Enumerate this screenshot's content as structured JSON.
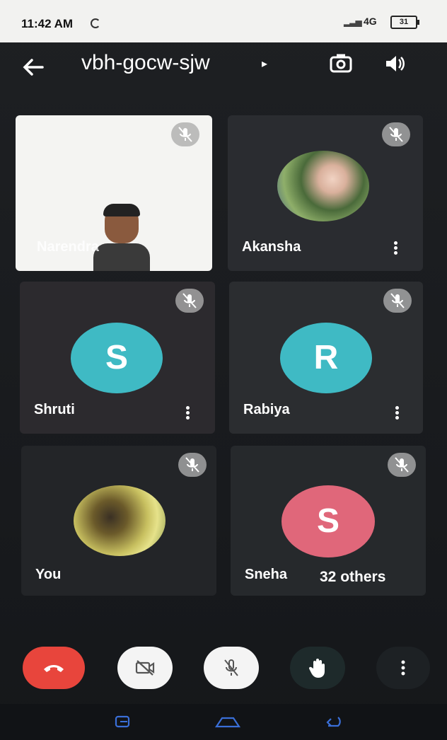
{
  "status_bar": {
    "time": "11:42 AM",
    "network": "4G",
    "battery": "31"
  },
  "header": {
    "meeting_code": "vbh-gocw-sjw"
  },
  "participants": [
    {
      "name": "Narendra",
      "muted": true,
      "type": "video"
    },
    {
      "name": "Akansha",
      "muted": true,
      "type": "photo"
    },
    {
      "name": "Shruti",
      "muted": true,
      "type": "initial",
      "initial": "S",
      "color": "#3fbac4"
    },
    {
      "name": "Rabiya",
      "muted": true,
      "type": "initial",
      "initial": "R",
      "color": "#3fbac4"
    },
    {
      "name": "You",
      "muted": true,
      "type": "photo"
    },
    {
      "name": "Sneha",
      "muted": true,
      "type": "initial",
      "initial": "S",
      "color": "#e0677a"
    }
  ],
  "others_count_label": "32 others",
  "colors": {
    "end_call": "#e8453c",
    "accent_teal": "#3fbac4",
    "accent_pink": "#e0677a"
  },
  "controls": [
    "end-call",
    "camera-off",
    "mic-off",
    "raise-hand",
    "more-options"
  ]
}
